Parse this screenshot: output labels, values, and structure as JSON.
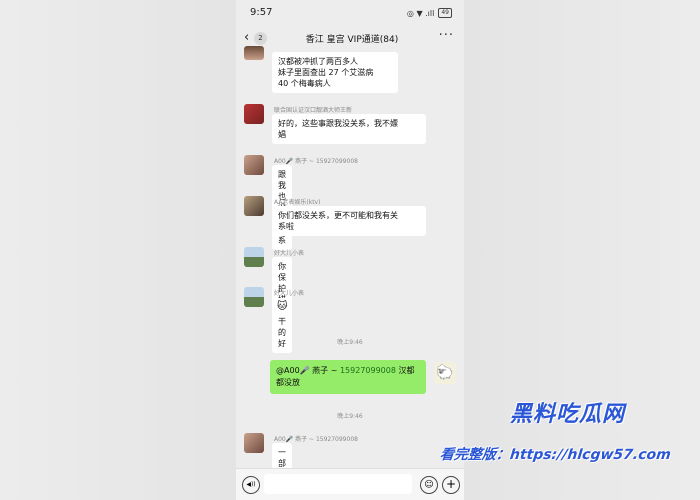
{
  "status_bar": {
    "time": "9:57",
    "icons": "◎ ▼ .ıll",
    "battery": "49"
  },
  "header": {
    "back": "‹",
    "unread": "2",
    "title": "香江 皇宫 VIP通道(84)",
    "more": "···"
  },
  "messages": [
    {
      "sender": "",
      "text": "汉都被冲抓了两百多人\n妹子里面查出 27 个艾滋病\n40 个梅毒病人"
    },
    {
      "sender": "联合国认证汉口靓酒大师王新",
      "text": "好的，这些事跟我没关系，我不嫖\n娼"
    },
    {
      "sender": "A00🎤 燕子 ~ 15927099008",
      "text": "跟我也没有关系"
    },
    {
      "sender": "AA老表娱乐(ktv)",
      "text": "你们都没关系，更不可能和我有关\n系啦"
    },
    {
      "sender": "好大儿小表",
      "text": "你保护措施干的好"
    },
    {
      "sender": "好大儿小表",
      "text": "🐱"
    },
    {
      "sender": "A00🎤 燕子 ~ 15927099008",
      "text": "一部分放了"
    }
  ],
  "time_separators": [
    "晚上9:46",
    "晚上9:46"
  ],
  "my_message": {
    "mention": "@A00🎤 燕子 ~ ",
    "phone": "15927099008",
    "rest": " 汉都都没放"
  },
  "my_avatar_emoji": "🐑",
  "input_bar": {
    "voice_icon": "◀))",
    "emoji_icon": "☺",
    "plus_icon": "+"
  },
  "watermark": {
    "line1": "黑料吃瓜网",
    "line2": "看完整版：https://hlcgw57.com"
  },
  "colors": {
    "my_bubble": "#95ec69",
    "watermark": "#2b57d6"
  }
}
